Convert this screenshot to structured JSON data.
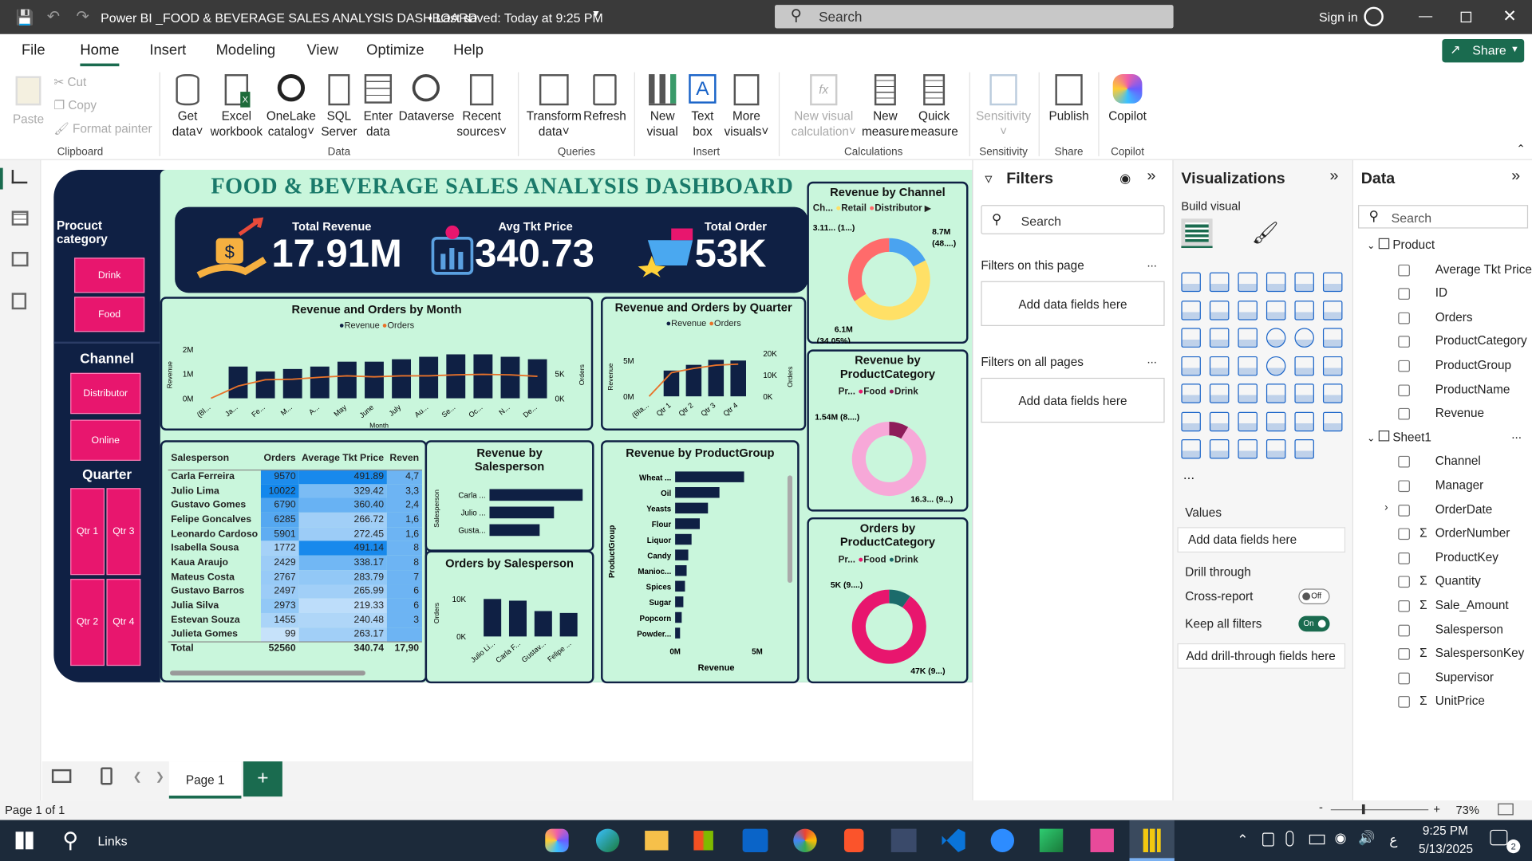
{
  "titlebar": {
    "title": "Power BI _FOOD & BEVERAGE SALES ANALYSIS DASHBOARD",
    "saved": "• Last saved: Today at 9:25 PM",
    "search": "Search",
    "signin": "Sign in"
  },
  "menu": {
    "file": "File",
    "home": "Home",
    "insert": "Insert",
    "modeling": "Modeling",
    "view": "View",
    "optimize": "Optimize",
    "help": "Help",
    "share": "Share"
  },
  "ribbon": {
    "paste": "Paste",
    "cut": "Cut",
    "copy": "Copy",
    "format_painter": "Format painter",
    "clipboard": "Clipboard",
    "get_data": "Get",
    "get_data2": "data",
    "excel": "Excel",
    "excel2": "workbook",
    "onelake": "OneLake",
    "onelake2": "catalog",
    "sql": "SQL",
    "sql2": "Server",
    "enter": "Enter",
    "enter2": "data",
    "dataverse": "Dataverse",
    "recent": "Recent",
    "recent2": "sources",
    "data_group": "Data",
    "transform": "Transform",
    "transform2": "data",
    "refresh": "Refresh",
    "queries": "Queries",
    "new_visual": "New",
    "new_visual2": "visual",
    "text_box": "Text",
    "text_box2": "box",
    "more_visuals": "More",
    "more_visuals2": "visuals",
    "insert_group": "Insert",
    "new_calc": "New visual",
    "new_calc2": "calculation",
    "new_measure": "New",
    "new_measure2": "measure",
    "quick_measure": "Quick",
    "quick_measure2": "measure",
    "calculations": "Calculations",
    "sensitivity": "Sensitivity",
    "sensitivity_group": "Sensitivity",
    "publish": "Publish",
    "share_group": "Share",
    "copilot": "Copilot",
    "copilot_group": "Copilot"
  },
  "dashboard": {
    "title": "FOOD & BEVERAGE SALES ANALYSIS DASHBOARD",
    "slicer_category_title": "Procuct category",
    "slicer_category": [
      "Drink",
      "Food"
    ],
    "slicer_channel_title": "Channel",
    "slicer_channel": [
      "Distributor",
      "Online"
    ],
    "slicer_quarter_title": "Quarter",
    "slicer_quarter": [
      "Qtr 1",
      "Qtr 3",
      "Qtr 2",
      "Qtr 4"
    ],
    "kpi_revenue_label": "Total Revenue",
    "kpi_revenue": "17.91M",
    "kpi_price_label": "Avg Tkt Price",
    "kpi_price": "340.73",
    "kpi_orders_label": "Total Order",
    "kpi_orders": "53K"
  },
  "chart_data": [
    {
      "type": "bar",
      "title": "Revenue and Orders by Month",
      "legend": [
        "Revenue",
        "Orders"
      ],
      "categories": [
        "(Bl...",
        "Ja...",
        "Fe...",
        "M...",
        "A...",
        "May",
        "June",
        "July",
        "Au...",
        "Se...",
        "Oc...",
        "N...",
        "De..."
      ],
      "series": [
        {
          "name": "Revenue",
          "values": [
            0,
            1.3,
            1.1,
            1.2,
            1.3,
            1.5,
            1.5,
            1.6,
            1.7,
            1.8,
            1.8,
            1.7,
            1.6
          ]
        },
        {
          "name": "Orders",
          "values": [
            0,
            2500,
            3800,
            3900,
            4300,
            4600,
            4400,
            4600,
            4600,
            4800,
            4900,
            4800,
            4500
          ]
        }
      ],
      "yticks_left": [
        "2M",
        "1M",
        "0M"
      ],
      "yticks_right": [
        "5K",
        "0K"
      ],
      "ylabel": "Revenue",
      "ylabel2": "Orders",
      "xlabel": "Month"
    },
    {
      "type": "bar",
      "title": "Revenue and Orders by Quarter",
      "legend": [
        "Revenue",
        "Orders"
      ],
      "categories": [
        "(Bla...",
        "Qtr 1",
        "Qtr 2",
        "Qtr 3",
        "Qtr 4"
      ],
      "series": [
        {
          "name": "Revenue",
          "values": [
            0,
            3.6,
            4.4,
            5.1,
            5.0
          ]
        },
        {
          "name": "Orders",
          "values": [
            0,
            11000,
            13000,
            14500,
            15000
          ]
        }
      ],
      "yticks_left": [
        "5M",
        "0M"
      ],
      "yticks_right": [
        "20K",
        "10K",
        "0K"
      ],
      "ylabel": "Revenue",
      "ylabel2": "Orders"
    },
    {
      "type": "pie",
      "title": "Revenue by Channel",
      "legend_title": "Ch...",
      "legend": [
        "Retail",
        "Distributor"
      ],
      "labels": [
        "3.11... (1...)",
        "8.7M (48....)",
        "6.1M (34.05%)"
      ],
      "values": [
        3.11,
        8.7,
        6.1
      ],
      "colors": [
        "#4aa3f0",
        "#ffe066",
        "#ff6b6b"
      ]
    },
    {
      "type": "pie",
      "title": "Revenue by ProductCategory",
      "legend_title": "Pr...",
      "legend": [
        "Food",
        "Drink"
      ],
      "labels": [
        "1.54M (8....)",
        "16.3... (9...)"
      ],
      "values": [
        1.54,
        16.37
      ],
      "colors": [
        "#8e1c5a",
        "#f7a8d8"
      ]
    },
    {
      "type": "pie",
      "title": "Orders by ProductCategory",
      "legend_title": "Pr...",
      "legend": [
        "Food",
        "Drink"
      ],
      "labels": [
        "5K (9....)",
        "47K (9...)"
      ],
      "values": [
        5,
        47
      ],
      "colors": [
        "#1b6b6b",
        "#e8166e"
      ]
    },
    {
      "type": "bar",
      "title": "Revenue by Salesperson",
      "categories": [
        "Carla ...",
        "Julio ...",
        "Gusta..."
      ],
      "values": [
        2.6,
        1.8,
        1.4
      ],
      "ylabel": "Salesperson"
    },
    {
      "type": "bar",
      "title": "Orders by Salesperson",
      "categories": [
        "Julio Li...",
        "Carla F...",
        "Gustav...",
        "Felipe ..."
      ],
      "values": [
        10022,
        9570,
        6790,
        6285
      ],
      "yticks": [
        "10K",
        "0K"
      ],
      "ylabel": "Orders"
    },
    {
      "type": "bar",
      "title": "Revenue by ProductGroup",
      "categories": [
        "Wheat ...",
        "Oil",
        "Yeasts",
        "Flour",
        "Liquor",
        "Candy",
        "Manioc...",
        "Spices",
        "Sugar",
        "Popcorn",
        "Powder..."
      ],
      "values": [
        4.2,
        2.7,
        2.0,
        1.5,
        1.0,
        0.8,
        0.7,
        0.6,
        0.5,
        0.4,
        0.3
      ],
      "xticks": [
        "0M",
        "5M"
      ],
      "xlabel": "Revenue",
      "ylabel": "ProductGroup"
    },
    {
      "type": "table",
      "headers": [
        "Salesperson",
        "Orders",
        "Average Tkt Price",
        "Reven"
      ],
      "rows": [
        [
          "Carla Ferreira",
          "9570",
          "491.89",
          "4,7"
        ],
        [
          "Julio Lima",
          "10022",
          "329.42",
          "3,3"
        ],
        [
          "Gustavo Gomes",
          "6790",
          "360.40",
          "2,4"
        ],
        [
          "Felipe Goncalves",
          "6285",
          "266.72",
          "1,6"
        ],
        [
          "Leonardo Cardoso",
          "5901",
          "272.45",
          "1,6"
        ],
        [
          "Isabella Sousa",
          "1772",
          "491.14",
          "8"
        ],
        [
          "Kaua Araujo",
          "2429",
          "338.17",
          "8"
        ],
        [
          "Mateus Costa",
          "2767",
          "283.79",
          "7"
        ],
        [
          "Gustavo Barros",
          "2497",
          "265.99",
          "6"
        ],
        [
          "Julia Silva",
          "2973",
          "219.33",
          "6"
        ],
        [
          "Estevan Souza",
          "1455",
          "240.48",
          "3"
        ],
        [
          "Julieta Gomes",
          "99",
          "263.17",
          ""
        ]
      ],
      "total": [
        "Total",
        "52560",
        "340.74",
        "17,90"
      ]
    }
  ],
  "filters": {
    "title": "Filters",
    "search": "Search",
    "on_page": "Filters on this page",
    "on_all": "Filters on all pages",
    "add": "Add data fields here",
    "more": "..."
  },
  "viz": {
    "title": "Visualizations",
    "build": "Build visual",
    "values": "Values",
    "add": "Add data fields here",
    "drill": "Drill through",
    "cross": "Cross-report",
    "cross_state": "Off",
    "keep": "Keep all filters",
    "keep_state": "On",
    "add_drill": "Add drill-through fields here",
    "more": "..."
  },
  "data": {
    "title": "Data",
    "search": "Search",
    "table1": "Product",
    "table1_fields": [
      "Average Tkt Price",
      "ID",
      "Orders",
      "ProductCategory",
      "ProductGroup",
      "ProductName",
      "Revenue"
    ],
    "table2": "Sheet1",
    "table2_fields": [
      "Channel",
      "Manager",
      "OrderDate",
      "OrderNumber",
      "ProductKey",
      "Quantity",
      "Sale_Amount",
      "Salesperson",
      "SalespersonKey",
      "Supervisor",
      "UnitPrice"
    ],
    "more": "..."
  },
  "pages": {
    "page1": "Page 1",
    "add": "+"
  },
  "status": {
    "page": "Page 1 of 1",
    "zoom": "73%"
  },
  "taskbar": {
    "search": "Links",
    "time": "9:25 PM",
    "date": "5/13/2025",
    "lang": "ع",
    "notif": "2"
  }
}
